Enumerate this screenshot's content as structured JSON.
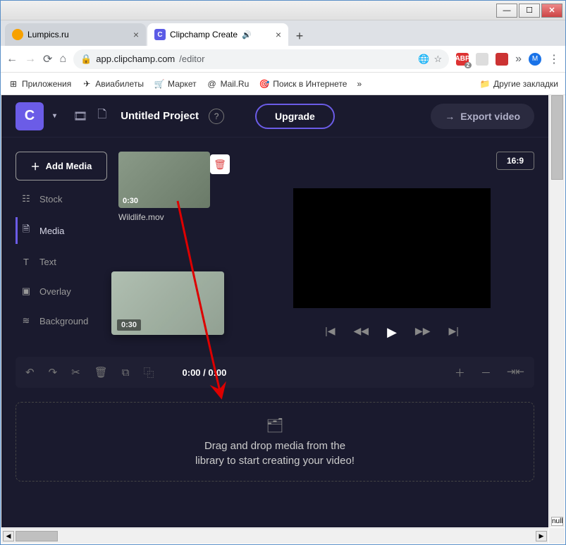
{
  "tabs": [
    {
      "title": "Lumpics.ru"
    },
    {
      "title": "Clipchamp Create",
      "favicon_letter": "C"
    }
  ],
  "url": {
    "domain": "app.clipchamp.com",
    "path": "/editor"
  },
  "ext": {
    "abp": "ABP",
    "abp_badge": "2",
    "avatar": "M"
  },
  "bookmarks": {
    "apps": "Приложения",
    "avia": "Авиабилеты",
    "market": "Маркет",
    "mail": "Mail.Ru",
    "search": "Поиск в Интернете",
    "more": "»",
    "other": "Другие закладки"
  },
  "app": {
    "logo": "C",
    "project_title": "Untitled Project",
    "upgrade": "Upgrade",
    "export": "Export video"
  },
  "sidebar": {
    "add": "Add Media",
    "items": [
      {
        "icon": "📦",
        "label": "Stock"
      },
      {
        "icon": "🗎",
        "label": "Media"
      },
      {
        "icon": "T",
        "label": "Text"
      },
      {
        "icon": "▣",
        "label": "Overlay"
      },
      {
        "icon": "≋",
        "label": "Background"
      }
    ]
  },
  "media": {
    "duration": "0:30",
    "name": "Wildlife.mov",
    "ghost_duration": "0:30"
  },
  "preview": {
    "ratio": "16:9"
  },
  "timeline": {
    "time": "0:00 / 0:00"
  },
  "dropzone": {
    "line1": "Drag and drop media from the",
    "line2": "library to start creating your video!"
  },
  "scroll": {
    "null": "null"
  }
}
